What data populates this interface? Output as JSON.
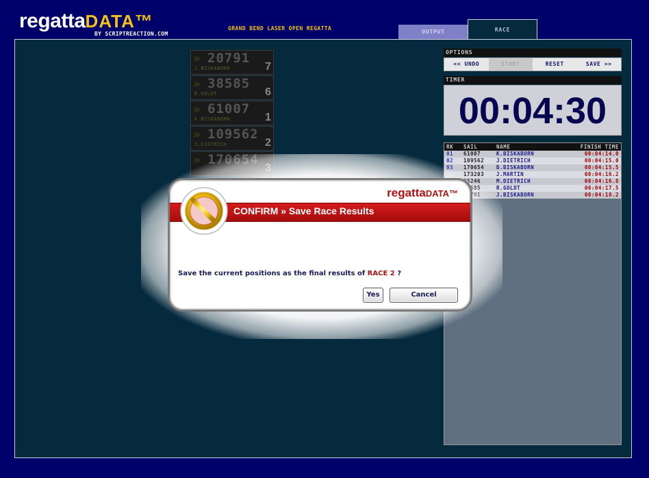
{
  "header": {
    "logo_main": "regatta",
    "logo_accent": "DATA™",
    "logo_sub": "BY SCRIPTREACTION.COM",
    "event_title": "GRAND BEND LASER OPEN REGATTA",
    "tabs": [
      {
        "label": "OUTPUT",
        "active": false
      },
      {
        "label": "RACE",
        "active": true
      }
    ]
  },
  "boats": [
    {
      "sail": "20791",
      "name": "J.BISKABORN",
      "position": "7"
    },
    {
      "sail": "38585",
      "name": "R.GOLDT",
      "position": "6"
    },
    {
      "sail": "61007",
      "name": "K.BISKABORN",
      "position": "1"
    },
    {
      "sail": "109562",
      "name": "J.DIETRICH",
      "position": "2"
    },
    {
      "sail": "170654",
      "name": "",
      "position": "3"
    }
  ],
  "options": {
    "title": "OPTIONS",
    "undo": "<< UNDO",
    "start": "START",
    "reset": "RESET",
    "save": "SAVE >>"
  },
  "timer": {
    "title": "TIMER",
    "value": "00:04:30"
  },
  "results": {
    "headers": {
      "rk": "RK",
      "sail": "SAIL",
      "name": "NAME",
      "time": "FINISH TIME"
    },
    "rows": [
      {
        "rk": "01",
        "sail": "61007",
        "name": "K.BISKABORN",
        "time": "00:04:14.0"
      },
      {
        "rk": "02",
        "sail": "109562",
        "name": "J.DIETRICH",
        "time": "00:04:15.0"
      },
      {
        "rk": "03",
        "sail": "170654",
        "name": "B.BISKABORN",
        "time": "00:04:15.5"
      },
      {
        "rk": "",
        "sail": "173203",
        "name": "J.MARTIN",
        "time": "00:04:16.2"
      },
      {
        "rk": "",
        "sail": "25246",
        "name": "M.DIETRICH",
        "time": "00:04:16.8"
      },
      {
        "rk": "",
        "sail": "38585",
        "name": "R.GOLDT",
        "time": "00:04:17.5"
      },
      {
        "rk": "",
        "sail": "20791",
        "name": "J.BISKABORN",
        "time": "00:04:18.2"
      }
    ]
  },
  "modal": {
    "brand_main": "regatta",
    "brand_accent": "DATA™",
    "title": "CONFIRM » Save Race Results",
    "message_prefix": "Save the current positions as the final results of ",
    "message_highlight": "RACE 2",
    "message_suffix": " ?",
    "yes_label": "Yes",
    "cancel_label": "Cancel"
  },
  "colors": {
    "background": "#00006b",
    "panel": "#062a3d",
    "accent_yellow": "#f2c21a",
    "alert_red": "#b11010"
  }
}
